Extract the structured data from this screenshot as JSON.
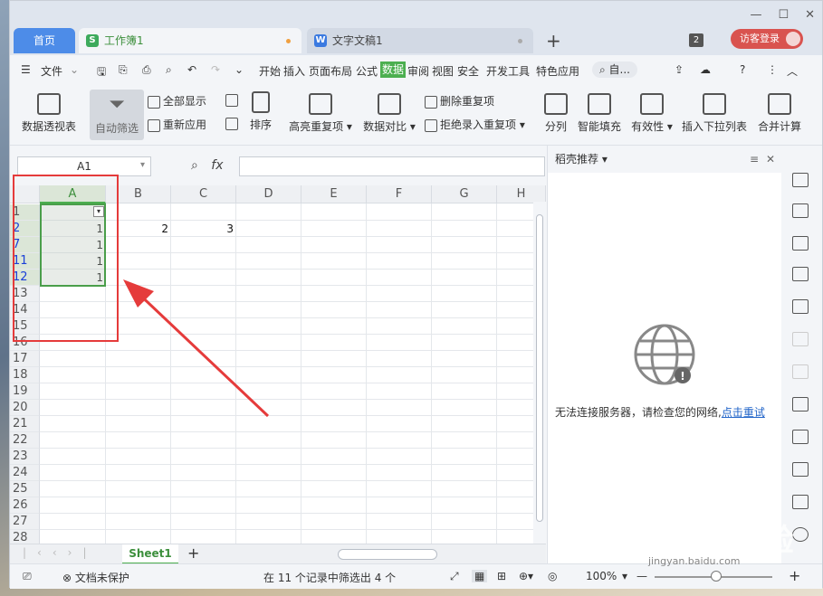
{
  "window": {
    "tabs": [
      {
        "label": "首页"
      },
      {
        "label": "工作簿1",
        "icon": "S"
      },
      {
        "label": "文字文稿1",
        "icon": "W"
      }
    ],
    "window_count": "2",
    "login_label": "访客登录"
  },
  "menu": {
    "file": "文件",
    "items": [
      "开始",
      "插入",
      "页面布局",
      "公式",
      "数据",
      "审阅",
      "视图",
      "安全",
      "开发工具",
      "特色应用"
    ],
    "active": "数据",
    "search": "自..."
  },
  "ribbon": {
    "pivot": "数据透视表",
    "autofilter": "自动筛选",
    "show_all": "全部显示",
    "reapply": "重新应用",
    "sort": "排序",
    "highlight_dup": "高亮重复项",
    "compare": "数据对比",
    "remove_dup": "删除重复项",
    "reject_dup": "拒绝录入重复项",
    "split": "分列",
    "smart_fill": "智能填充",
    "validity": "有效性",
    "dropdown": "插入下拉列表",
    "merge_calc": "合并计算"
  },
  "formula": {
    "cell_ref": "A1",
    "fx": "fx",
    "value": ""
  },
  "grid": {
    "columns": [
      "A",
      "B",
      "C",
      "D",
      "E",
      "F",
      "G",
      "H"
    ],
    "rows": [
      {
        "num": "1",
        "a": "",
        "b": "",
        "c": ""
      },
      {
        "num": "2",
        "a": "1",
        "b": "2",
        "c": "3"
      },
      {
        "num": "7",
        "a": "1",
        "b": "",
        "c": ""
      },
      {
        "num": "11",
        "a": "1",
        "b": "",
        "c": ""
      },
      {
        "num": "12",
        "a": "1",
        "b": "",
        "c": ""
      },
      {
        "num": "13",
        "a": "",
        "b": "",
        "c": ""
      },
      {
        "num": "14",
        "a": "",
        "b": "",
        "c": ""
      },
      {
        "num": "15",
        "a": "",
        "b": "",
        "c": ""
      },
      {
        "num": "16",
        "a": "",
        "b": "",
        "c": ""
      },
      {
        "num": "17",
        "a": "",
        "b": "",
        "c": ""
      },
      {
        "num": "18",
        "a": "",
        "b": "",
        "c": ""
      },
      {
        "num": "19",
        "a": "",
        "b": "",
        "c": ""
      },
      {
        "num": "20",
        "a": "",
        "b": "",
        "c": ""
      },
      {
        "num": "21",
        "a": "",
        "b": "",
        "c": ""
      },
      {
        "num": "22",
        "a": "",
        "b": "",
        "c": ""
      },
      {
        "num": "23",
        "a": "",
        "b": "",
        "c": ""
      },
      {
        "num": "24",
        "a": "",
        "b": "",
        "c": ""
      },
      {
        "num": "25",
        "a": "",
        "b": "",
        "c": ""
      },
      {
        "num": "26",
        "a": "",
        "b": "",
        "c": ""
      },
      {
        "num": "27",
        "a": "",
        "b": "",
        "c": ""
      },
      {
        "num": "28",
        "a": "",
        "b": "",
        "c": ""
      }
    ]
  },
  "sheet": {
    "name": "Sheet1"
  },
  "side_panel": {
    "title": "稻壳推荐",
    "message": "无法连接服务器，请检查您的网络,",
    "retry": "点击重试"
  },
  "status": {
    "protect": "文档未保护",
    "filter_info": "在 11 个记录中筛选出 4 个",
    "zoom": "100%"
  },
  "watermark": "Baidu经验",
  "watermark_sub": "jingyan.baidu.com"
}
